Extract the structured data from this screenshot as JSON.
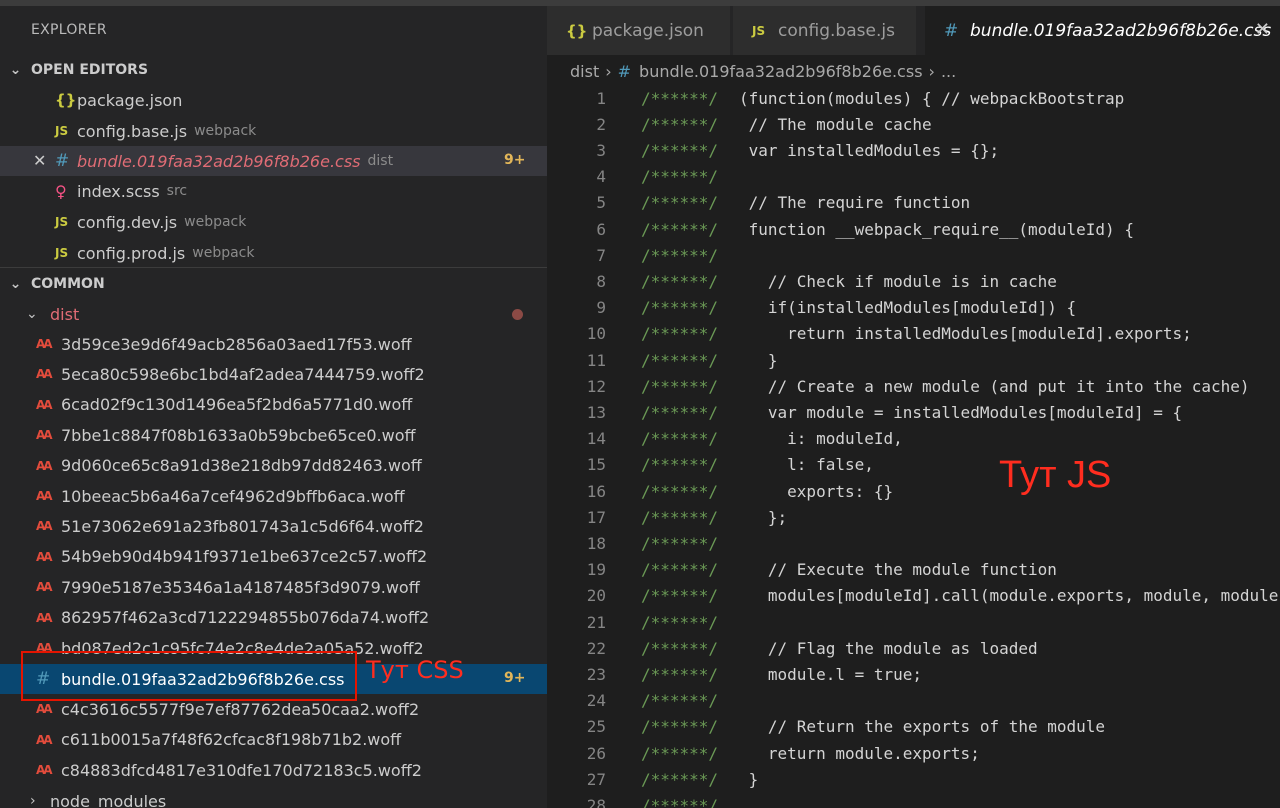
{
  "sidebar": {
    "title": "EXPLORER",
    "open_editors": {
      "label": "OPEN EDITORS",
      "items": [
        {
          "icon": "{}",
          "name": "package.json",
          "desc": ""
        },
        {
          "icon": "JS",
          "name": "config.base.js",
          "desc": "webpack"
        },
        {
          "icon": "#",
          "name": "bundle.019faa32ad2b96f8b26e.css",
          "desc": "dist",
          "badge": "9+"
        },
        {
          "icon": "scss-icon",
          "name": "index.scss",
          "desc": "src"
        },
        {
          "icon": "JS",
          "name": "config.dev.js",
          "desc": "webpack"
        },
        {
          "icon": "JS",
          "name": "config.prod.js",
          "desc": "webpack"
        }
      ]
    },
    "common": {
      "label": "COMMON",
      "dist_folder": "dist",
      "files": [
        "3d59ce3e9d6f49acb2856a03aed17f53.woff",
        "5eca80c598e6bc1bd4af2adea7444759.woff2",
        "6cad02f9c130d1496ea5f2bd6a5771d0.woff",
        "7bbe1c8847f08b1633a0b59bcbe65ce0.woff",
        "9d060ce65c8a91d38e218db97dd82463.woff",
        "10beeac5b6a46a7cef4962d9bffb6aca.woff",
        "51e73062e691a23fb801743a1c5d6f64.woff2",
        "54b9eb90d4b941f9371e1be637ce2c57.woff2",
        "7990e5187e35346a1a4187485f3d9079.woff",
        "862957f462a3cd7122294855b076da74.woff2",
        "bd087ed2c1c95fc74e2c8e4de2a05a52.woff2"
      ],
      "selected_file": "bundle.019faa32ad2b96f8b26e.css",
      "selected_badge": "9+",
      "files_after": [
        "c4c3616c5577f9e7ef87762dea50caa2.woff2",
        "c611b0015a7f48f62cfcac8f198b71b2.woff",
        "c84883dfcd4817e310dfe170d72183c5.woff2"
      ],
      "node_modules": "node_modules"
    },
    "annotation": "Тут CSS"
  },
  "tabs": [
    {
      "icon": "{}",
      "label": "package.json"
    },
    {
      "icon": "JS",
      "label": "config.base.js"
    },
    {
      "icon": "#",
      "label": "bundle.019faa32ad2b96f8b26e.css",
      "close": "✕"
    }
  ],
  "breadcrumb": {
    "folder": "dist",
    "sep": "›",
    "icon": "#",
    "file": "bundle.019faa32ad2b96f8b26e.css",
    "more": "..."
  },
  "code": {
    "comment_prefix": "/******/",
    "lines": [
      {
        "n": "1",
        "t": "(function(modules) { // webpackBootstrap"
      },
      {
        "n": "2",
        "t": " // The module cache"
      },
      {
        "n": "3",
        "t": " var installedModules = {};"
      },
      {
        "n": "4",
        "t": ""
      },
      {
        "n": "5",
        "t": " // The require function"
      },
      {
        "n": "6",
        "t": " function __webpack_require__(moduleId) {"
      },
      {
        "n": "7",
        "t": ""
      },
      {
        "n": "8",
        "t": "   // Check if module is in cache"
      },
      {
        "n": "9",
        "t": "   if(installedModules[moduleId]) {"
      },
      {
        "n": "10",
        "t": "     return installedModules[moduleId].exports;"
      },
      {
        "n": "11",
        "t": "   }"
      },
      {
        "n": "12",
        "t": "   // Create a new module (and put it into the cache)"
      },
      {
        "n": "13",
        "t": "   var module = installedModules[moduleId] = {"
      },
      {
        "n": "14",
        "t": "     i: moduleId,"
      },
      {
        "n": "15",
        "t": "     l: false,"
      },
      {
        "n": "16",
        "t": "     exports: {}"
      },
      {
        "n": "17",
        "t": "   };"
      },
      {
        "n": "18",
        "t": ""
      },
      {
        "n": "19",
        "t": "   // Execute the module function"
      },
      {
        "n": "20",
        "t": "   modules[moduleId].call(module.exports, module, module.exports, __webpack_require__);"
      },
      {
        "n": "21",
        "t": ""
      },
      {
        "n": "22",
        "t": "   // Flag the module as loaded"
      },
      {
        "n": "23",
        "t": "   module.l = true;"
      },
      {
        "n": "24",
        "t": ""
      },
      {
        "n": "25",
        "t": "   // Return the exports of the module"
      },
      {
        "n": "26",
        "t": "   return module.exports;"
      },
      {
        "n": "27",
        "t": " }"
      },
      {
        "n": "28",
        "t": ""
      }
    ],
    "annotation": "Тут JS"
  }
}
